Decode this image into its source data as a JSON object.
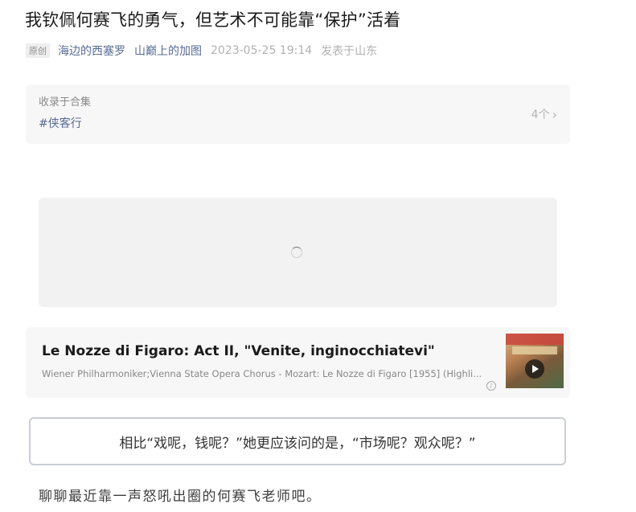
{
  "article": {
    "title": "我钦佩何赛飞的勇气，但艺术不可能靠“保护”活着",
    "original_tag": "原创",
    "author": "海边的西塞罗",
    "account": "山巅上的加图",
    "datetime": "2023-05-25 19:14",
    "location": "发表于山东"
  },
  "collection": {
    "label": "收录于合集",
    "tag": "#侠客行",
    "count": "4个",
    "chevron_icon": "chevron-right-icon"
  },
  "music": {
    "title": "Le Nozze di Figaro: Act II, \"Venite, inginocchiatevi\"",
    "subtitle": "Wiener Philharmoniker;Vienna State Opera Chorus - Mozart: Le Nozze di Figaro [1955] (Highli...",
    "play_icon": "play-icon",
    "logo_icon": "music-logo-icon"
  },
  "quote": "相比“戏呢，钱呢？”她更应该问的是，“市场呢？观众呢？”",
  "body_first_line": "聊聊最近靠一声怒吼出圈的何赛飞老师吧。",
  "colors": {
    "link": "#576b95",
    "muted": "#b2b2b2",
    "card_bg": "#f7f7f7",
    "quote_border": "#c9ced6"
  }
}
